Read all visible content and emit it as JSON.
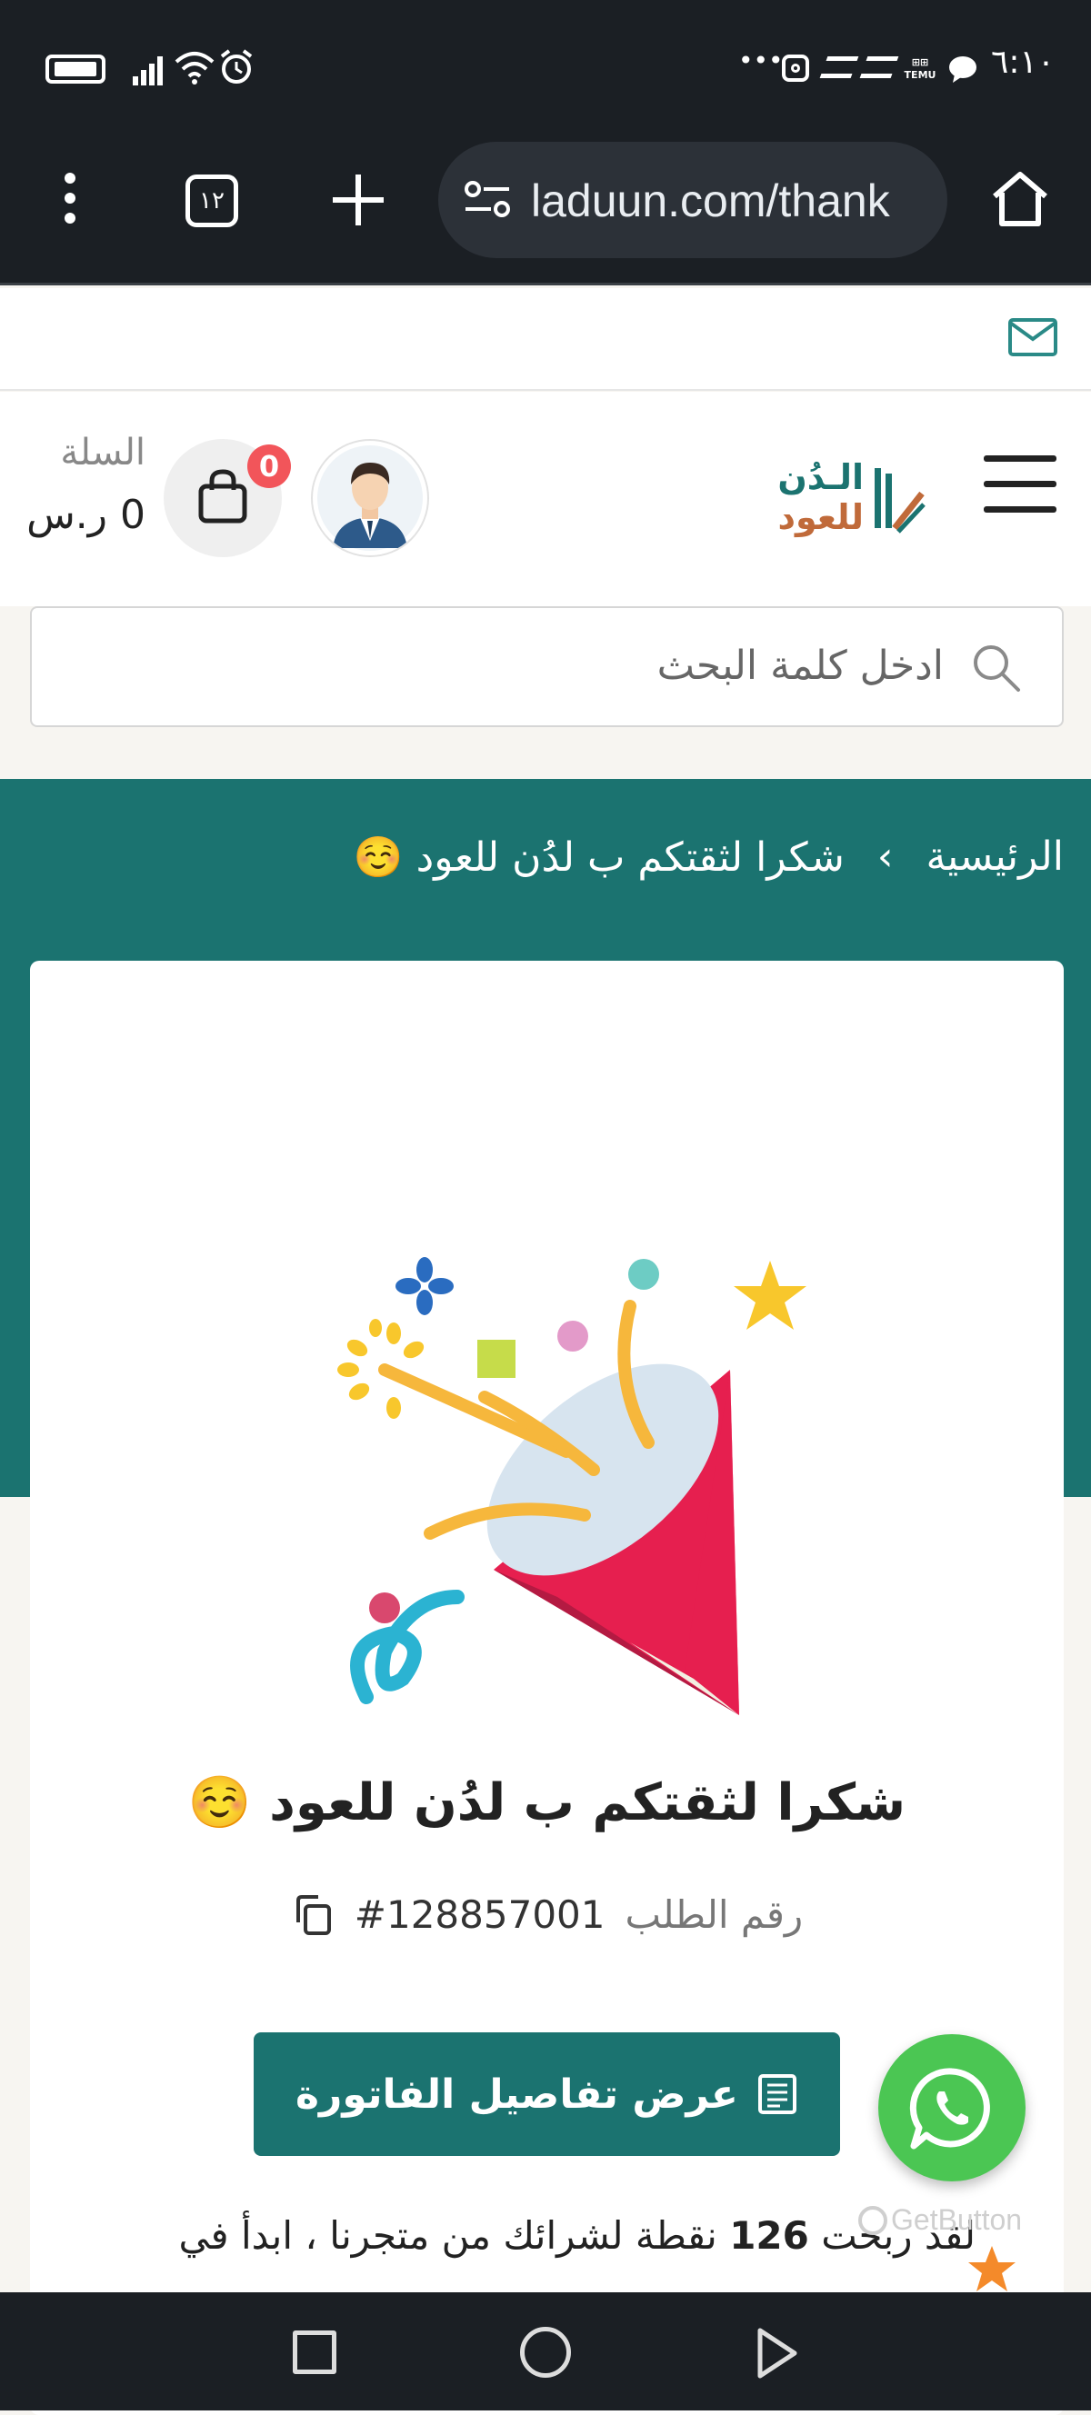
{
  "status_bar": {
    "time": "٦:١٠",
    "more": "•••"
  },
  "browser": {
    "tab_count": "١٢",
    "url": "laduun.com/thank"
  },
  "header": {
    "cart_label": "السلة",
    "cart_total": "0 ر.س",
    "cart_badge": "0",
    "logo_line1": "الـدُن",
    "logo_line2": "للعود"
  },
  "search": {
    "placeholder": "ادخل كلمة البحث"
  },
  "breadcrumb": {
    "home": "الرئيسية",
    "separator": "›",
    "current": "شكرا لثقتكم ب لدُن للعود ☺️"
  },
  "thanks": {
    "title": "شكرا لثقتكم ب لدُن للعود ☺️",
    "order_label": "رقم الطلب",
    "order_number": "#128857001",
    "invoice_button": "عرض تفاصيل الفاتورة",
    "points_line1_pre": "لقد ربحت",
    "points_value": "126",
    "points_line1_post": "نقطة لشرائك من متجرنا ، ابدأ في"
  },
  "widget": {
    "getbutton": "GetButton"
  },
  "colors": {
    "primary": "#1b7370",
    "whatsapp": "#4bc653",
    "badge": "#f2555a"
  }
}
